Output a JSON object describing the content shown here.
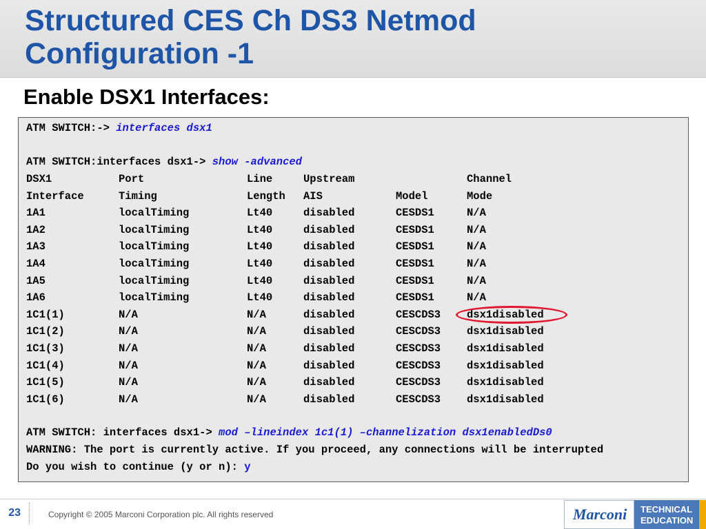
{
  "slide": {
    "title_line1": "Structured CES Ch DS3 Netmod",
    "title_line2": "Configuration -1",
    "subtitle": "Enable DSX1 Interfaces:"
  },
  "terminal": {
    "cmd1_prompt": "ATM SWITCH:-> ",
    "cmd1_input": "interfaces dsx1",
    "cmd2_prompt": "ATM SWITCH:interfaces dsx1-> ",
    "cmd2_input": "show -advanced",
    "header1": [
      "DSX1",
      "Port",
      "Line",
      "Upstream",
      "",
      "Channel"
    ],
    "header2": [
      "Interface",
      "Timing",
      "Length",
      "AIS",
      "Model",
      "Mode"
    ],
    "rows": [
      [
        "1A1",
        "localTiming",
        "Lt40",
        "disabled",
        "CESDS1",
        "N/A"
      ],
      [
        "1A2",
        "localTiming",
        "Lt40",
        "disabled",
        "CESDS1",
        "N/A"
      ],
      [
        "1A3",
        "localTiming",
        "Lt40",
        "disabled",
        "CESDS1",
        "N/A"
      ],
      [
        "1A4",
        "localTiming",
        "Lt40",
        "disabled",
        "CESDS1",
        "N/A"
      ],
      [
        "1A5",
        "localTiming",
        "Lt40",
        "disabled",
        "CESDS1",
        "N/A"
      ],
      [
        "1A6",
        "localTiming",
        "Lt40",
        "disabled",
        "CESDS1",
        "N/A"
      ],
      [
        "1C1(1)",
        "N/A",
        "N/A",
        "disabled",
        "CESCDS3",
        "dsx1disabled"
      ],
      [
        "1C1(2)",
        "N/A",
        "N/A",
        "disabled",
        "CESCDS3",
        "dsx1disabled"
      ],
      [
        "1C1(3)",
        "N/A",
        "N/A",
        "disabled",
        "CESCDS3",
        "dsx1disabled"
      ],
      [
        "1C1(4)",
        "N/A",
        "N/A",
        "disabled",
        "CESCDS3",
        "dsx1disabled"
      ],
      [
        "1C1(5)",
        "N/A",
        "N/A",
        "disabled",
        "CESCDS3",
        "dsx1disabled"
      ],
      [
        "1C1(6)",
        "N/A",
        "N/A",
        "disabled",
        "CESCDS3",
        "dsx1disabled"
      ]
    ],
    "cmd3_prompt": "ATM SWITCH: interfaces dsx1-> ",
    "cmd3_input": "mod –lineindex 1c1(1) –channelization dsx1enabledDs0",
    "warning": "WARNING: The port is currently active. If you proceed, any connections will be interrupted",
    "confirm_prompt": "Do you wish to continue (y or n): ",
    "confirm_input": "y"
  },
  "footer": {
    "page_number": "23",
    "copyright": "Copyright © 2005 Marconi Corporation plc. All rights reserved",
    "logo_text": "Marconi",
    "badge_line1": "TECHNICAL",
    "badge_line2": "EDUCATION"
  },
  "colors": {
    "title": "#1f55a6",
    "command_input": "#1a1ad6",
    "highlight_ring": "#e0172f",
    "badge_bg": "#4a78b8",
    "accent_bar": "#f2a900"
  }
}
